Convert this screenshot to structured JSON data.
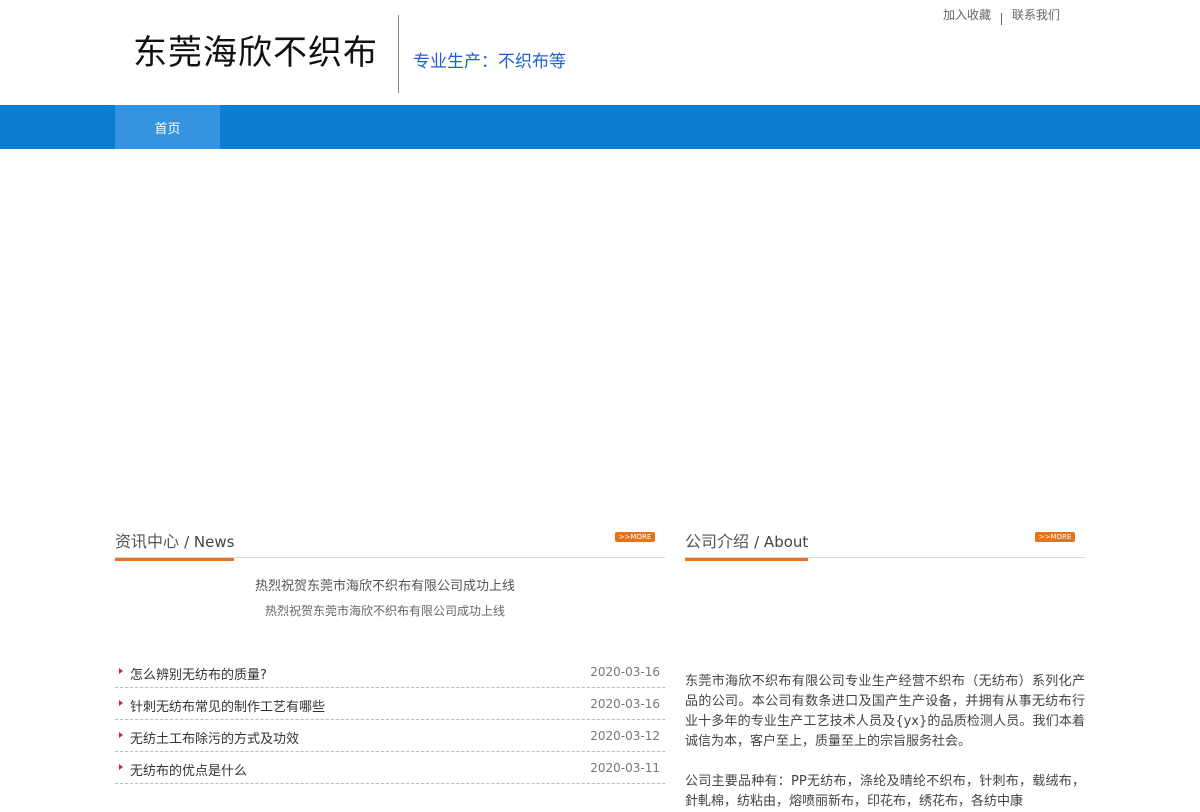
{
  "header": {
    "logo_text": "东莞海欣不织布",
    "slogan": "专业生产：不织布等",
    "links": [
      "加入收藏",
      "联系我们"
    ]
  },
  "nav": {
    "items": [
      "首页"
    ]
  },
  "news": {
    "title_cn": "资讯中心",
    "title_en": "/ News",
    "more": ">>MORE",
    "featured_title": "热烈祝贺东莞市海欣不织布有限公司成功上线",
    "featured_sub": "热烈祝贺东莞市海欣不织布有限公司成功上线",
    "items": [
      {
        "title": "怎么辨别无纺布的质量?",
        "date": "2020-03-16"
      },
      {
        "title": "针刺无纺布常见的制作工艺有哪些",
        "date": "2020-03-16"
      },
      {
        "title": "无纺土工布除污的方式及功效",
        "date": "2020-03-12"
      },
      {
        "title": "无纺布的优点是什么",
        "date": "2020-03-11"
      }
    ]
  },
  "about": {
    "title_cn": "公司介绍",
    "title_en": "/ About",
    "more": ">>MORE",
    "para1": "东莞市海欣不织布有限公司专业生产经营不织布（无纺布）系列化产品的公司。本公司有数条进口及国产生产设备，并拥有从事无纺布行业十多年的专业生产工艺技术人员及{yx}的品质检测人员。我们本着诚信为本，客户至上，质量至上的宗旨服务社会。",
    "para2": " 公司主要品种有：PP无纺布，涤纶及晴纶不织布，针刺布，载绒布，針軋棉，纺粘由，熔喷丽新布，印花布，绣花布，各纺中康"
  }
}
